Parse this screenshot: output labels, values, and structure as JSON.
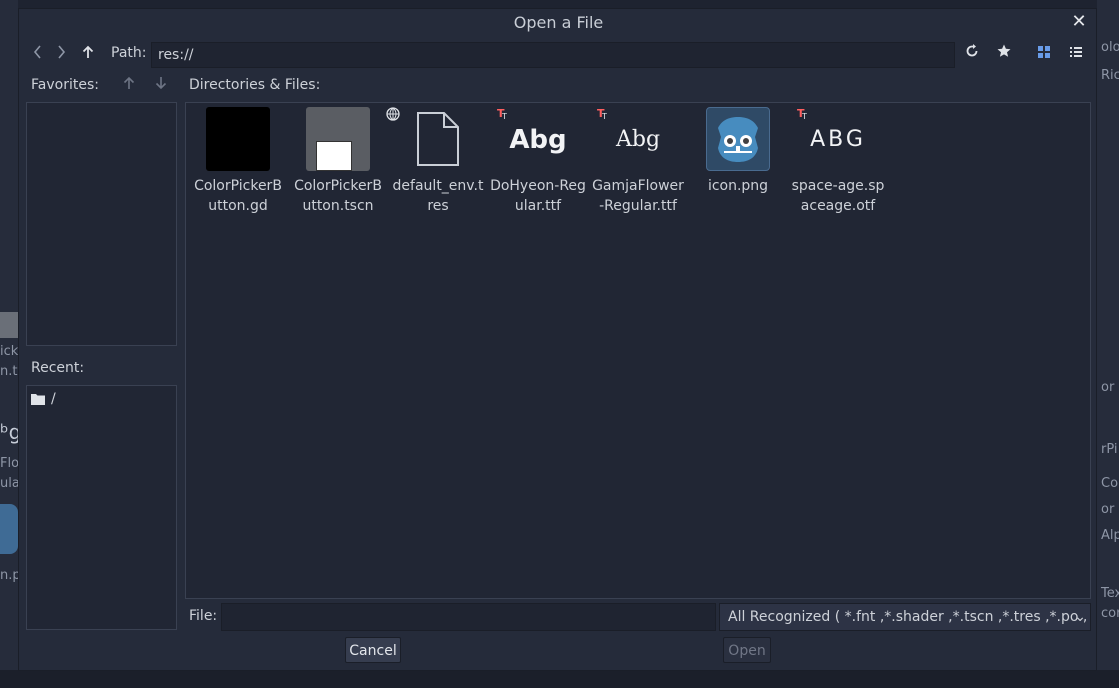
{
  "dialog": {
    "title": "Open a File",
    "path_label": "Path:",
    "path_value": "res://",
    "favorites_label": "Favorites:",
    "recent_label": "Recent:",
    "recent_items": [
      "/"
    ],
    "dirs_label": "Directories & Files:",
    "file_label": "File:",
    "file_value": "",
    "filter_value": "All Recognized ( *.fnt ,*.shader ,*.tscn ,*.tres ,*.po , ...",
    "cancel_label": "Cancel",
    "open_label": "Open"
  },
  "files": [
    {
      "name": "ColorPickerButton.gd",
      "icon": "gdscript-thumb"
    },
    {
      "name": "ColorPickerButton.tscn",
      "icon": "scene-thumb"
    },
    {
      "name": "default_env.tres",
      "icon": "file-icon"
    },
    {
      "name": "DoHyeon-Regular.ttf",
      "icon": "font-preview",
      "preview": "Abg"
    },
    {
      "name": "GamjaFlower-Regular.ttf",
      "icon": "font-preview",
      "preview": "Abg"
    },
    {
      "name": "icon.png",
      "icon": "godot-icon"
    },
    {
      "name": "space-age.spaceage.otf",
      "icon": "font-preview",
      "preview": "ABG"
    }
  ],
  "background": {
    "left_snippets": [
      "ick",
      "n.ts",
      "ᵇg",
      "Flo",
      "ula",
      "n.pn"
    ],
    "right_snippets": [
      "olor",
      "Rich",
      "or",
      "rPi",
      "Co",
      "or",
      "Alp",
      "Tex",
      "con"
    ]
  },
  "colors": {
    "accent": "#699ce8",
    "dialog_bg": "#252b3a",
    "panel_bg": "#212634"
  }
}
